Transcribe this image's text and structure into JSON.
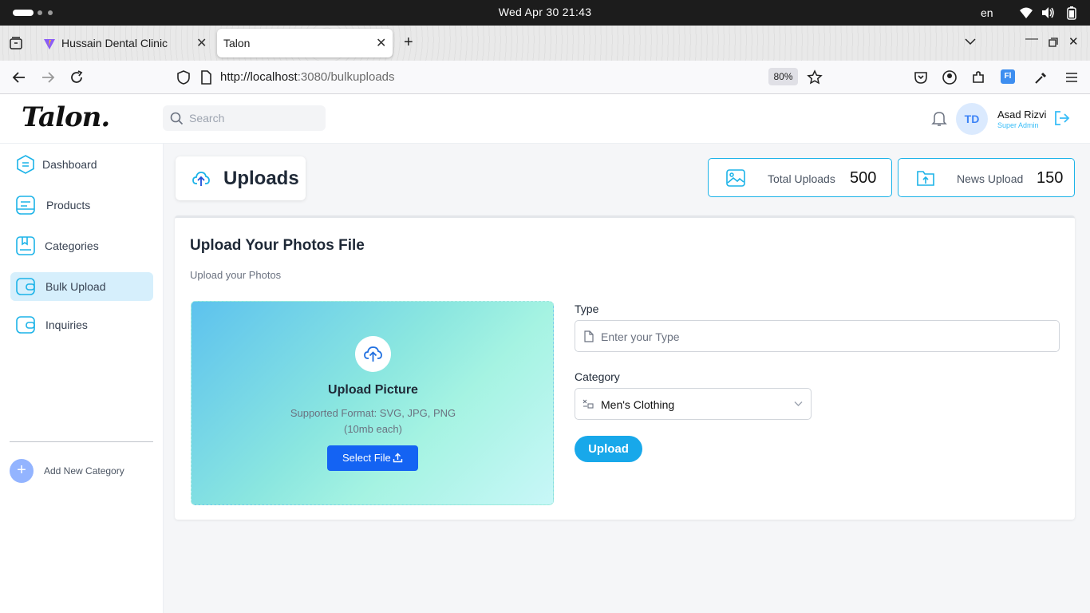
{
  "os": {
    "clock": "Wed Apr 30  21:43",
    "language": "en",
    "icons": [
      "wifi-icon",
      "volume-icon",
      "battery-icon"
    ]
  },
  "browser": {
    "tabs": [
      {
        "title": "Hussain Dental Clinic",
        "icon": "vite-logo-icon",
        "active": false
      },
      {
        "title": "Talon",
        "active": true
      }
    ],
    "url_host": "http://localhost",
    "url_rest": ":3080/bulkuploads",
    "zoom": "80%"
  },
  "header": {
    "logo": "Talon.",
    "search_placeholder": "Search",
    "avatar_initials": "TD",
    "user_name": "Asad Rizvi",
    "user_role": "Super Admin"
  },
  "sidebar": {
    "items": [
      {
        "label": "Dashboard",
        "icon": "dashboard-icon"
      },
      {
        "label": "Products",
        "icon": "products-icon"
      },
      {
        "label": "Categories",
        "icon": "categories-icon"
      },
      {
        "label": "Bulk Upload",
        "icon": "bulk-upload-icon",
        "active": true
      },
      {
        "label": "Inquiries",
        "icon": "inquiries-icon"
      }
    ],
    "add_category": "Add New Category"
  },
  "page": {
    "title": "Uploads",
    "stats": [
      {
        "label": "Total Uploads",
        "value": "500",
        "icon": "image-icon"
      },
      {
        "label": "News Upload",
        "value": "150",
        "icon": "folder-upload-icon"
      }
    ]
  },
  "upload_card": {
    "title": "Upload Your Photos File",
    "subtitle": "Upload your Photos",
    "dropzone_title": "Upload Picture",
    "dropzone_formats": "Supported Format: SVG, JPG, PNG",
    "dropzone_size": "(10mb each)",
    "select_file": "Select File",
    "type_label": "Type",
    "type_placeholder": "Enter your Type",
    "category_label": "Category",
    "category_value": "Men's Clothing",
    "upload_button": "Upload"
  },
  "colors": {
    "accent": "#1cb3e8",
    "primary_button": "#1463f3",
    "upload_button": "#18a8ea",
    "active_nav": "#d6effc"
  }
}
